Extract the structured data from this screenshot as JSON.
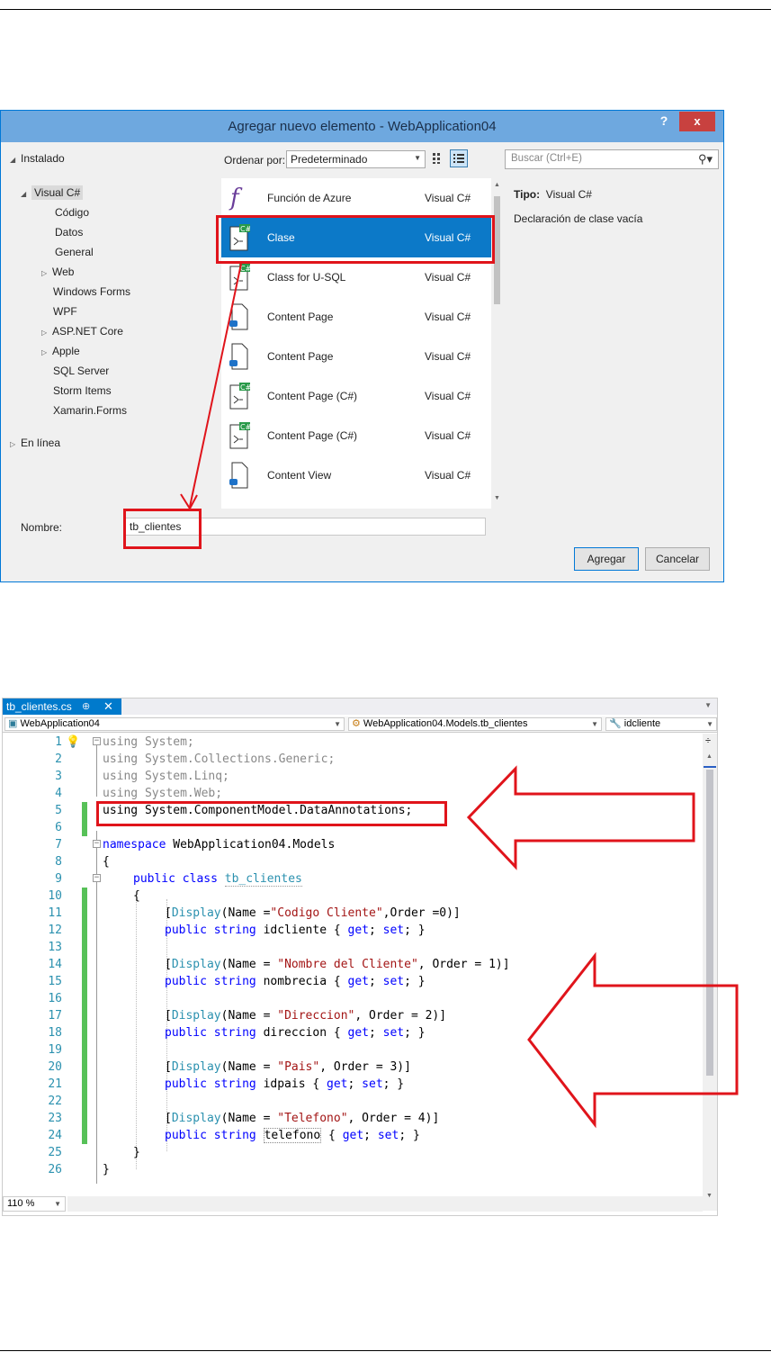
{
  "dialog": {
    "title": "Agregar nuevo elemento - WebApplication04",
    "help_label": "?",
    "close_label": "x",
    "left_tree": {
      "installed": "Instalado",
      "visual_csharp": "Visual C#",
      "children": [
        "Código",
        "Datos",
        "General",
        "Web",
        "Windows Forms",
        "WPF",
        "ASP.NET Core",
        "Apple",
        "SQL Server",
        "Storm Items",
        "Xamarin.Forms"
      ],
      "online": "En línea"
    },
    "sort_label": "Ordenar por:",
    "sort_value": "Predeterminado",
    "search_placeholder": "Buscar (Ctrl+E)",
    "templates": [
      {
        "name": "Función de Azure",
        "lang": "Visual C#",
        "icon": "azure-function-icon"
      },
      {
        "name": "Clase",
        "lang": "Visual C#",
        "icon": "class-icon",
        "selected": true
      },
      {
        "name": "Class for U-SQL",
        "lang": "Visual C#",
        "icon": "class-icon"
      },
      {
        "name": "Content Page",
        "lang": "Visual C#",
        "icon": "page-icon"
      },
      {
        "name": "Content Page",
        "lang": "Visual C#",
        "icon": "page-icon"
      },
      {
        "name": "Content Page (C#)",
        "lang": "Visual C#",
        "icon": "class-icon"
      },
      {
        "name": "Content Page (C#)",
        "lang": "Visual C#",
        "icon": "class-icon"
      },
      {
        "name": "Content View",
        "lang": "Visual C#",
        "icon": "page-icon"
      }
    ],
    "details": {
      "type_label": "Tipo:",
      "type_value": "Visual C#",
      "description": "Declaración de clase vacía"
    },
    "name_label": "Nombre:",
    "name_value": "tb_clientes",
    "add_button": "Agregar",
    "cancel_button": "Cancelar"
  },
  "editor": {
    "tab_title": "tb_clientes.cs",
    "tab_pin": "⊕",
    "tab_close": "✕",
    "nav_project": "WebApplication04",
    "nav_class": "WebApplication04.Models.tb_clientes",
    "nav_member": "idcliente",
    "zoom": "110 %",
    "line_numbers": [
      "1",
      "2",
      "3",
      "4",
      "5",
      "6",
      "7",
      "8",
      "9",
      "10",
      "11",
      "12",
      "13",
      "14",
      "15",
      "16",
      "17",
      "18",
      "19",
      "20",
      "21",
      "22",
      "23",
      "24",
      "25",
      "26"
    ],
    "code": {
      "l1": "using System;",
      "l2": "using System.Collections.Generic;",
      "l3": "using System.Linq;",
      "l4": "using System.Web;",
      "l5": "using System.ComponentModel.DataAnnotations;",
      "l7_kw": "namespace",
      "l7_name": " WebApplication04.Models",
      "brace_open": "{",
      "brace_close": "}",
      "l9_kw": "public class ",
      "l9_name": "tb_clientes",
      "display": "Display",
      "name_eq": "Name =",
      "name_eq_sp": "Name = ",
      "order0": ",Order =0)]",
      "s11": "\"Codigo Cliente\"",
      "s14": "\"Nombre del Cliente\"",
      "s17": "\"Direccion\"",
      "s20": "\"Pais\"",
      "s23": "\"Telefono\"",
      "o1": ", Order = 1)]",
      "o2": ", Order = 2)]",
      "o3": ", Order = 3)]",
      "o4": ", Order = 4)]",
      "ps": "public string ",
      "f12": "idcliente",
      "f15": "nombrecia",
      "f18": "direccion",
      "f21": "idpais",
      "f24": "telefono",
      "getset_open": " { ",
      "get": "get",
      "set": "set",
      "getset_close": "; }"
    }
  }
}
